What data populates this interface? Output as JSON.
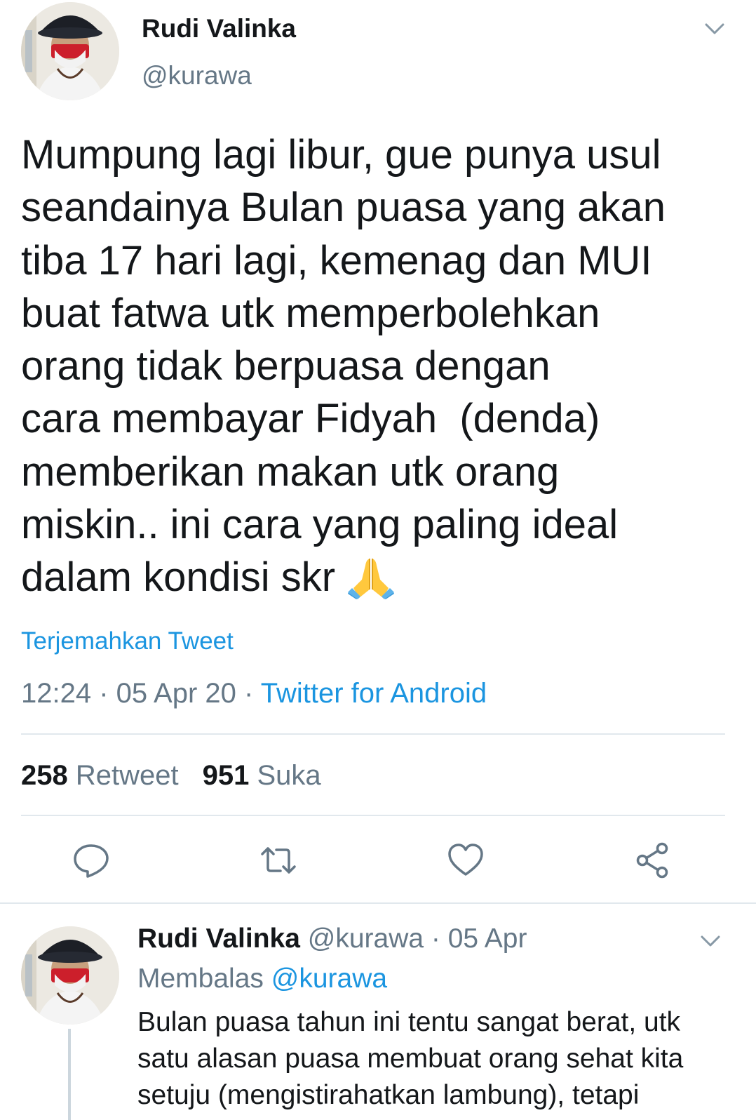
{
  "main_tweet": {
    "author_name": "Rudi Valinka",
    "author_handle": "@kurawa",
    "text_lines": [
      "Mumpung lagi libur, gue punya usul",
      "seandainya Bulan puasa yang akan",
      "tiba 17 hari lagi, kemenag dan MUI",
      "buat fatwa utk memperbolehkan",
      "orang tidak berpuasa dengan",
      "cara membayar Fidyah  (denda)",
      "memberikan makan utk orang",
      "miskin.. ini cara yang paling ideal",
      "dalam kondisi skr"
    ],
    "emoji": "folded-hands-icon",
    "translate_label": "Terjemahkan Tweet",
    "time": "12:24",
    "separator": " · ",
    "date": "05 Apr 20",
    "source": "Twitter for Android",
    "retweet_count": "258",
    "retweet_label": "Retweet",
    "like_count": "951",
    "like_label": "Suka",
    "actions": [
      "reply-icon",
      "retweet-icon",
      "like-icon",
      "share-icon"
    ]
  },
  "reply_tweet": {
    "author_name": "Rudi Valinka",
    "author_handle": "@kurawa",
    "date": "05 Apr",
    "separator": " · ",
    "replying_to_label": "Membalas",
    "replying_to_handle": "@kurawa",
    "text_lines": [
      "Bulan puasa tahun ini tentu sangat berat, utk",
      "satu alasan puasa membuat orang sehat kita",
      "setuju (mengistirahatkan lambung), tetapi"
    ]
  },
  "colors": {
    "text_primary": "#14171a",
    "text_secondary": "#657786",
    "link_blue": "#1b95e0",
    "divider": "#e1e8ed"
  }
}
